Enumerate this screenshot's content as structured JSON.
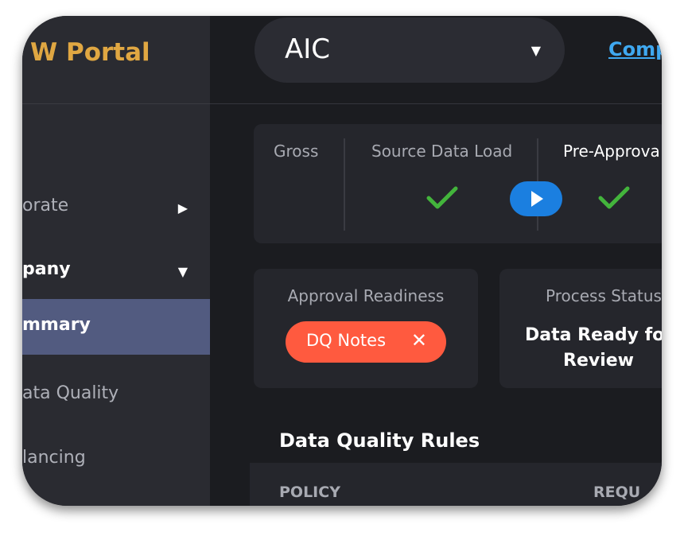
{
  "sidebar": {
    "brand": "W Portal",
    "items": [
      {
        "label": "orate",
        "chevron": "chevron-right-icon"
      },
      {
        "label": "pany",
        "chevron": "chevron-down-icon"
      },
      {
        "label": "mmary"
      },
      {
        "label": "ata Quality"
      },
      {
        "label": "lancing"
      }
    ]
  },
  "header": {
    "company_select_value": "AIC",
    "link_label": "Comp"
  },
  "steps": [
    {
      "title": "Gross"
    },
    {
      "title": "Source Data Load",
      "status": "complete"
    },
    {
      "title": "Pre-Approva",
      "status": "complete"
    }
  ],
  "approval": {
    "title": "Approval Readiness",
    "pill_label": "DQ Notes"
  },
  "process_status": {
    "title": "Process Status",
    "line1": "Data Ready fo",
    "line2": "Review"
  },
  "section_title": "Data Quality Rules",
  "table": {
    "columns": [
      "POLICY",
      "REQU"
    ]
  },
  "colors": {
    "brand": "#e0a742",
    "accent_blue": "#1b7fe0",
    "check_green": "#43b43c",
    "alert_red": "#ff5a3f",
    "active_nav": "#525b80"
  }
}
